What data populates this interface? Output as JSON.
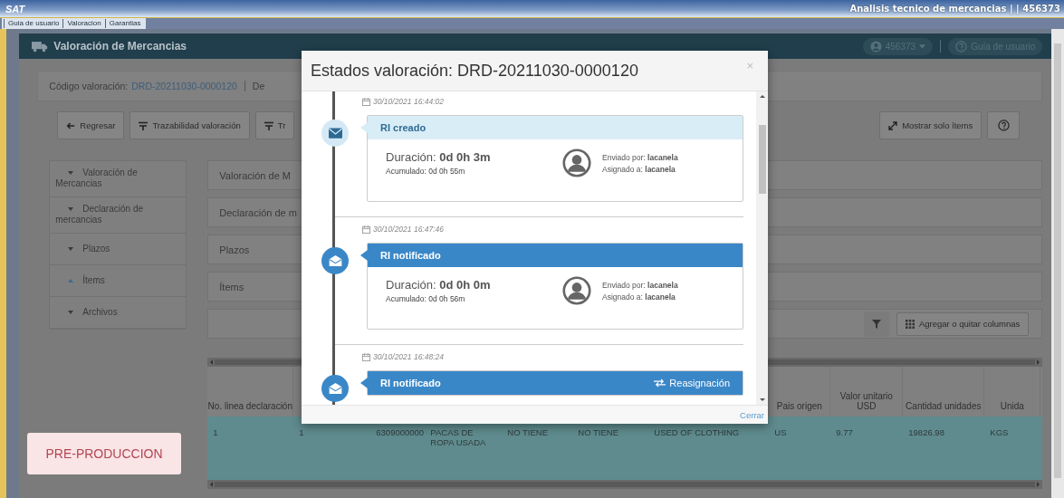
{
  "top_bar": {
    "logo": "SAT",
    "context": "Analisis tecnico de mercancias | | 456373"
  },
  "menu_links": [
    {
      "label": "Guia de usuario"
    },
    {
      "label": "Valoracion"
    },
    {
      "label": "Garantias"
    }
  ],
  "app_header": {
    "title": "Valoración de Mercancias",
    "user": "456373",
    "help": "Guía de usuario"
  },
  "code_row": {
    "label": "Código valoración:",
    "value": "DRD-20211030-0000120",
    "next": "De"
  },
  "toolbar": {
    "left": [
      {
        "label": "Regresar",
        "kind": "back"
      },
      {
        "label": "Trazabilidad valoración",
        "kind": "list"
      },
      {
        "label": "Tr",
        "kind": "list"
      }
    ],
    "show_items": "Mostrar solo ítems"
  },
  "accordion": [
    {
      "label": "Valoración de Mercancias",
      "expanded": false
    },
    {
      "label": "Declaración de mercancias",
      "expanded": false
    },
    {
      "label": "Plazos",
      "expanded": false
    },
    {
      "label": "Ítems",
      "expanded": true
    },
    {
      "label": "Archivos",
      "expanded": false
    }
  ],
  "panels": [
    {
      "title": "Valoración de M"
    },
    {
      "title": "Declaración de m"
    },
    {
      "title": "Plazos"
    },
    {
      "title": "Ítems"
    }
  ],
  "columns_button": "Agregar o quitar columnas",
  "table": {
    "columns": [
      {
        "header": "No. linea declaración"
      },
      null,
      null,
      null,
      null,
      null,
      null,
      {
        "header": "Pais origen"
      },
      {
        "header": "Valor unitario USD"
      },
      {
        "header": "Cantidad unidades"
      },
      {
        "header": "Unida"
      }
    ],
    "rows": [
      {
        "selected": true,
        "cells": [
          "1",
          "1",
          "6309000000",
          "PACAS DE ROPA USADA",
          "NO TIENE",
          "NO TIENE",
          "USED OF CLOTHING",
          "US",
          "9.77",
          "19826.98",
          "KGS"
        ]
      }
    ]
  },
  "badge": "PRE-PRODUCCION",
  "modal": {
    "title": "Estados valoración: DRD-20211030-0000120",
    "close": "×",
    "entries": [
      {
        "date": "30/10/2021 16:44:02",
        "kind": "created",
        "status": "RI creado",
        "duration": "Duración: **0d 0h 3m**",
        "accumulated": "Acumulado: 0d 0h 55m",
        "sent_by": "Enviado por: **lacanela**",
        "assigned_to": "Asignado a: **lacanela**"
      },
      {
        "date": "30/10/2021 16:47:46",
        "kind": "notified",
        "status": "RI notificado",
        "duration": "Duración: **0d 0h 0m**",
        "accumulated": "Acumulado: 0d 0h 56m",
        "sent_by": "Enviado por: **lacanela**",
        "assigned_to": "Asignado a: **lacanela**"
      },
      {
        "date": "30/10/2021 16:48:24",
        "kind": "notified",
        "status": "RI notificado",
        "action": "Reasignación"
      }
    ],
    "footer_link": "Cerrar"
  }
}
